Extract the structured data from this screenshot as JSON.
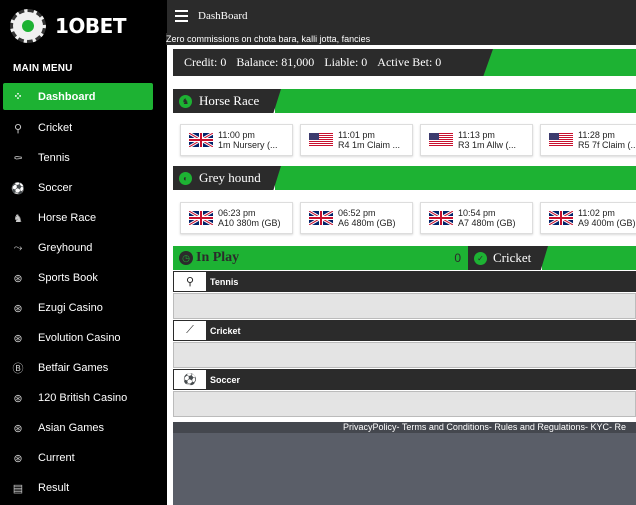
{
  "brand": {
    "name": "1OBET"
  },
  "sidebar": {
    "heading": "MAIN MENU",
    "items": [
      {
        "label": "Dashboard",
        "icon": "dashboard-icon",
        "active": true
      },
      {
        "label": "Cricket",
        "icon": "cricket-icon"
      },
      {
        "label": "Tennis",
        "icon": "tennis-icon"
      },
      {
        "label": "Soccer",
        "icon": "soccer-icon"
      },
      {
        "label": "Horse Race",
        "icon": "horse-icon"
      },
      {
        "label": "Greyhound",
        "icon": "greyhound-icon"
      },
      {
        "label": "Sports Book",
        "icon": "sportsbook-icon"
      },
      {
        "label": "Ezugi Casino",
        "icon": "casino-chip-icon"
      },
      {
        "label": "Evolution Casino",
        "icon": "casino-chip-icon"
      },
      {
        "label": "Betfair Games",
        "icon": "betfair-icon"
      },
      {
        "label": "120 British Casino",
        "icon": "casino-chip-icon"
      },
      {
        "label": "Asian Games",
        "icon": "casino-chip-icon"
      },
      {
        "label": "Current",
        "icon": "casino-chip-icon"
      },
      {
        "label": "Result",
        "icon": "result-icon"
      }
    ]
  },
  "topbar": {
    "title": "DashBoard"
  },
  "ticker": {
    "text": "Zero commissions on chota bara, kalli jotta, fancies"
  },
  "account": {
    "credit": "Credit: 0",
    "balance": "Balance: 81,000",
    "liable": "Liable: 0",
    "active_bet": "Active Bet: 0"
  },
  "horse_race": {
    "title": "Horse Race",
    "races": [
      {
        "flag": "gb",
        "time": "11:00 pm",
        "name": "1m Nursery (..."
      },
      {
        "flag": "us",
        "time": "11:01 pm",
        "name": "R4 1m Claim ..."
      },
      {
        "flag": "us",
        "time": "11:13 pm",
        "name": "R3 1m Allw (..."
      },
      {
        "flag": "us",
        "time": "11:28 pm",
        "name": "R5 7f Claim (..."
      }
    ]
  },
  "greyhound": {
    "title": "Grey hound",
    "races": [
      {
        "flag": "gb",
        "time": "06:23 pm",
        "name": "A10 380m (GB)"
      },
      {
        "flag": "gb",
        "time": "06:52 pm",
        "name": "A6 480m (GB)"
      },
      {
        "flag": "gb",
        "time": "10:54 pm",
        "name": "A7 480m (GB)"
      },
      {
        "flag": "gb",
        "time": "11:02 pm",
        "name": "A9 400m (GB)"
      }
    ]
  },
  "inplay": {
    "label": "In Play",
    "count": "0",
    "tab": "Cricket"
  },
  "sports": [
    {
      "name": "Tennis",
      "icon": "tennis-icon"
    },
    {
      "name": "Cricket",
      "icon": "cricket-icon"
    },
    {
      "name": "Soccer",
      "icon": "soccer-icon"
    }
  ],
  "footer": {
    "links": "PrivacyPolicy- Terms and Conditions- Rules and Regulations- KYC- Re"
  },
  "colors": {
    "accent": "#1db233",
    "dark": "#2b2b2b",
    "sidebar": "#000000",
    "footer": "#5a5e68"
  }
}
